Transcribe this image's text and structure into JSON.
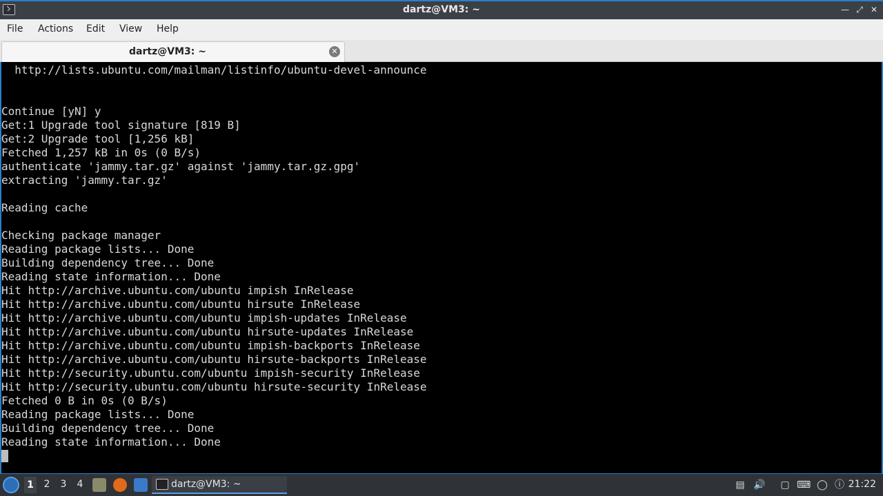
{
  "window": {
    "title": "dartz@VM3: ~"
  },
  "menu": {
    "items": [
      "File",
      "Actions",
      "Edit",
      "View",
      "Help"
    ]
  },
  "tabs": [
    {
      "label": "dartz@VM3: ~"
    }
  ],
  "terminal": {
    "lines": [
      "  http://lists.ubuntu.com/mailman/listinfo/ubuntu-devel-announce",
      "",
      "",
      "Continue [yN] y",
      "Get:1 Upgrade tool signature [819 B]",
      "Get:2 Upgrade tool [1,256 kB]",
      "Fetched 1,257 kB in 0s (0 B/s)",
      "authenticate 'jammy.tar.gz' against 'jammy.tar.gz.gpg'",
      "extracting 'jammy.tar.gz'",
      "",
      "Reading cache",
      "",
      "Checking package manager",
      "Reading package lists... Done",
      "Building dependency tree... Done",
      "Reading state information... Done",
      "Hit http://archive.ubuntu.com/ubuntu impish InRelease",
      "Hit http://archive.ubuntu.com/ubuntu hirsute InRelease",
      "Hit http://archive.ubuntu.com/ubuntu impish-updates InRelease",
      "Hit http://archive.ubuntu.com/ubuntu hirsute-updates InRelease",
      "Hit http://archive.ubuntu.com/ubuntu impish-backports InRelease",
      "Hit http://archive.ubuntu.com/ubuntu hirsute-backports InRelease",
      "Hit http://security.ubuntu.com/ubuntu impish-security InRelease",
      "Hit http://security.ubuntu.com/ubuntu hirsute-security InRelease",
      "Fetched 0 B in 0s (0 B/s)",
      "Reading package lists... Done",
      "Building dependency tree... Done",
      "Reading state information... Done"
    ]
  },
  "taskbar": {
    "workspaces": [
      "1",
      "2",
      "3",
      "4"
    ],
    "active_task": "dartz@VM3: ~",
    "clock": "21:22"
  },
  "colors": {
    "accent": "#2d7fc9",
    "terminal_bg": "#000000",
    "terminal_fg": "#d9d9d9"
  }
}
